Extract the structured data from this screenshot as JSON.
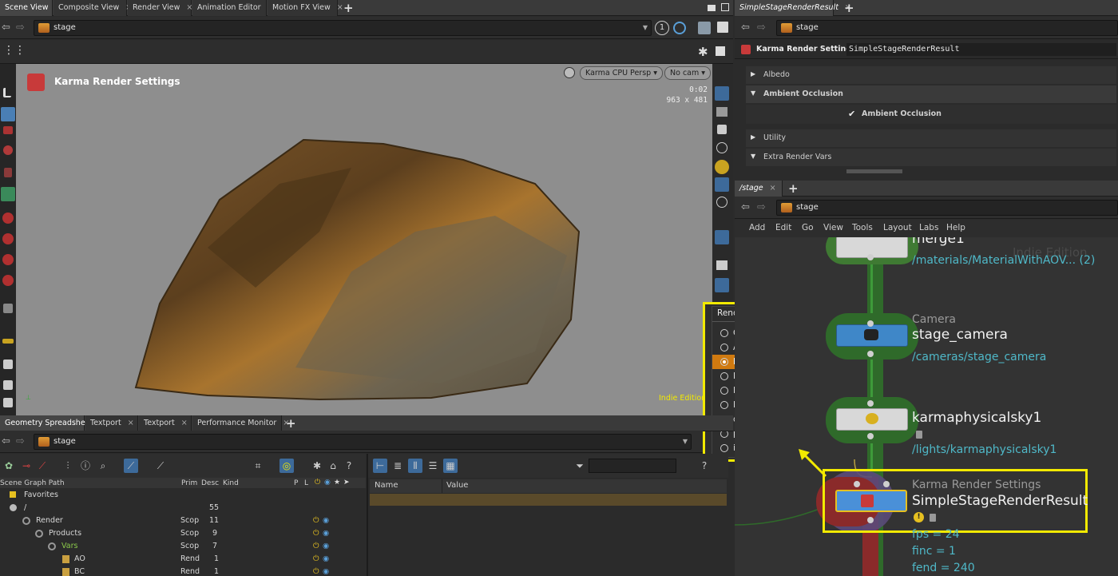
{
  "top_left_tabs": [
    "Scene View",
    "Composite View",
    "Render View",
    "Animation Editor",
    "Motion FX View"
  ],
  "scene_path": "stage",
  "viewport": {
    "title": "Karma Render Settings",
    "renderer_menu": "Karma CPU Persp",
    "camera_menu": "No cam",
    "time": "0:02",
    "resolution": "963 x 481",
    "edition": "Indie Edition"
  },
  "render_outputs_menu": {
    "header": "Render Outputs",
    "items": [
      "C",
      "AO",
      "BC",
      "MT",
      "NM",
      "RO",
      "depth",
      "primId",
      "instanceId"
    ],
    "selected": "BC"
  },
  "bottom_left_tabs": [
    "Geometry Spreadsheet",
    "Textport",
    "Textport",
    "Performance Monitor"
  ],
  "bottom_path": "stage",
  "scene_graph": {
    "headers": [
      "Scene Graph Path",
      "Prim",
      "Desc",
      "Kind",
      "P",
      "L"
    ],
    "rows": [
      {
        "name": "Favorites",
        "prim": "",
        "desc": ""
      },
      {
        "name": "/",
        "prim": "",
        "desc": "55"
      },
      {
        "name": "Render",
        "prim": "Scop",
        "desc": "11"
      },
      {
        "name": "Products",
        "prim": "Scop",
        "desc": "9"
      },
      {
        "name": "Vars",
        "prim": "Scop",
        "desc": "7"
      },
      {
        "name": "AO",
        "prim": "Rend",
        "desc": "1"
      },
      {
        "name": "BC",
        "prim": "Rend",
        "desc": "1"
      }
    ]
  },
  "properties_table": {
    "headers": [
      "Name",
      "Value"
    ]
  },
  "top_right_tab": "SimpleStageRenderResult",
  "top_right_path": "stage",
  "parameters": {
    "node_type": "Karma Render Settings",
    "node_name": "SimpleStageRenderResult",
    "sections": [
      "Albedo",
      "Ambient Occlusion",
      "Utility",
      "Extra Render Vars"
    ],
    "ao_toggle_label": "Ambient Occlusion"
  },
  "network": {
    "tab": "/stage",
    "path": "stage",
    "menu": [
      "Add",
      "Edit",
      "Go",
      "View",
      "Tools",
      "Layout",
      "Labs",
      "Help"
    ],
    "watermark": "Indie Edition",
    "nodes": {
      "merge": {
        "title": "merge1",
        "path": "/materials/MaterialWithAOV... (2)"
      },
      "camera": {
        "type": "Camera",
        "title": "stage_camera",
        "path": "/cameras/stage_camera"
      },
      "sky": {
        "title": "karmaphysicalsky1",
        "path": "/lights/karmaphysicalsky1"
      },
      "render": {
        "type": "Karma Render Settings",
        "title": "SimpleStageRenderResult",
        "info": [
          "fps = 24",
          "finc = 1",
          "fend = 240"
        ]
      }
    }
  },
  "colors": {
    "highlight": "#f2ea00",
    "selected_row": "#d07a10",
    "node_green": "#3f7a33",
    "node_blue": "#3f87c8",
    "node_red": "#8a2a2a",
    "path_teal": "#4fb8c8"
  }
}
